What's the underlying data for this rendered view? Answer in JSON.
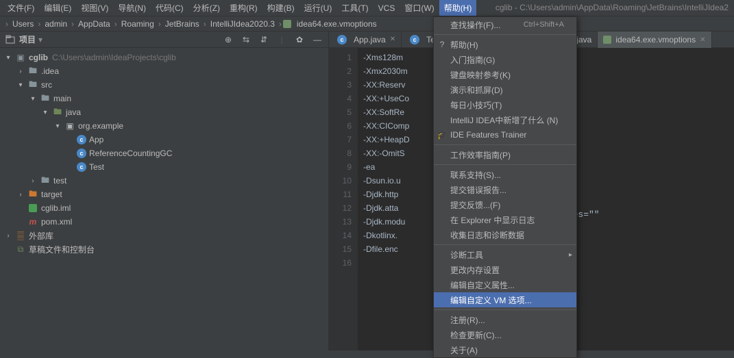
{
  "window_title": "cglib - C:\\Users\\admin\\AppData\\Roaming\\JetBrains\\IntelliJIdea2",
  "menu": {
    "file": "文件(F)",
    "edit": "编辑(E)",
    "view": "视图(V)",
    "navigate": "导航(N)",
    "code": "代码(C)",
    "analyze": "分析(Z)",
    "refactor": "重构(R)",
    "build": "构建(B)",
    "run": "运行(U)",
    "tools": "工具(T)",
    "vcs": "VCS",
    "window": "窗口(W)",
    "help": "帮助(H)"
  },
  "breadcrumb": [
    "Users",
    "admin",
    "AppData",
    "Roaming",
    "JetBrains",
    "IntelliJIdea2020.3",
    "idea64.exe.vmoptions"
  ],
  "panel": {
    "title": "项目"
  },
  "tree": {
    "root": {
      "label": "cglib",
      "hint": "C:\\Users\\admin\\IdeaProjects\\cglib"
    },
    "idea": ".idea",
    "src": "src",
    "main": "main",
    "java": "java",
    "pkg": "org.example",
    "app": "App",
    "ref": "ReferenceCountingGC",
    "test_cls": "Test",
    "test_dir": "test",
    "target": "target",
    "iml": "cglib.iml",
    "pom": "pom.xml",
    "external": "外部库",
    "scratch": "草稿文件和控制台"
  },
  "tabs": {
    "app": "App.java",
    "tes": "Tes",
    "java_partial": ".java",
    "idea64": "idea64.exe.vmoptions"
  },
  "editor": {
    "lines": [
      "-Xms128m",
      "-Xmx2030m",
      "-XX:Reserv",
      "-XX:+UseCo",
      "-XX:SoftRe",
      "-XX:CIComp",
      "-XX:+HeapD",
      "-XX:-OmitS",
      "-ea",
      "-Dsun.io.u",
      "-Djdk.http",
      "-Djdk.atta",
      "-Djdk.modu",
      "-Dkotlinx.",
      "-Dfile.enc"
    ],
    "line_numbers": [
      "1",
      "2",
      "3",
      "4",
      "5",
      "6",
      "7",
      "8",
      "9",
      "10",
      "11",
      "12",
      "13",
      "14",
      "15",
      "16"
    ],
    "far_text": "emes=\"\""
  },
  "help_menu": {
    "find_action": "查找操作(F)...",
    "find_action_sc": "Ctrl+Shift+A",
    "help": "帮助(H)",
    "getting_started": "入门指南(G)",
    "keymap": "键盘映射参考(K)",
    "demos": "演示和抓屏(D)",
    "tip": "每日小技巧(T)",
    "whatsnew": "IntelliJ IDEA中新增了什么 (N)",
    "features": "IDE Features Trainer",
    "productivity": "工作效率指南(P)",
    "contact": "联系支持(S)...",
    "submit_bug": "提交错误报告...",
    "submit_feedback": "提交反馈...(F)",
    "show_log": "在 Explorer 中显示日志",
    "collect_logs": "收集日志和诊断数据",
    "diagnostic": "诊断工具",
    "change_mem": "更改内存设置",
    "edit_props": "编辑自定义属性...",
    "edit_vm": "编辑自定义 VM 选项...",
    "register": "注册(R)...",
    "check_updates": "检查更新(C)...",
    "about": "关于(A)"
  }
}
